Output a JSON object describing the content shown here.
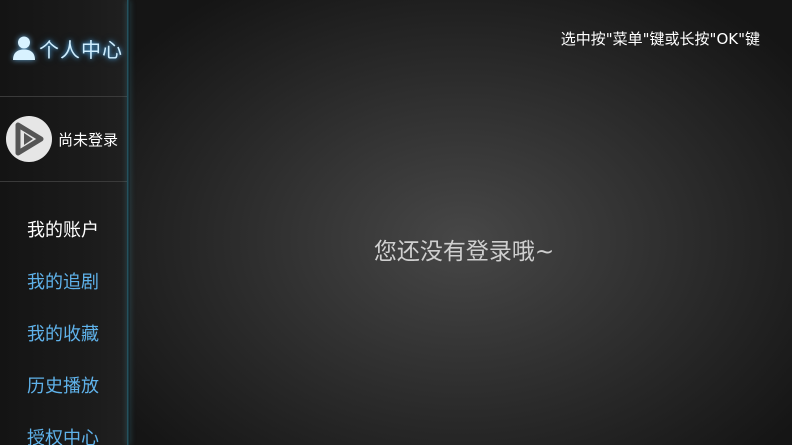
{
  "sidebar": {
    "title": "个人中心",
    "title_icon": "person-icon",
    "user": {
      "avatar_icon": "play-logo-icon",
      "status": "尚未登录"
    },
    "items": [
      {
        "label": "我的账户",
        "active": true
      },
      {
        "label": "我的追剧",
        "active": false
      },
      {
        "label": "我的收藏",
        "active": false
      },
      {
        "label": "历史播放",
        "active": false
      },
      {
        "label": "授权中心",
        "active": false
      }
    ]
  },
  "main": {
    "hint": "选中按\"菜单\"键或长按\"OK\"键",
    "empty_message": "您还没有登录哦~"
  },
  "colors": {
    "accent": "#5fb2ea",
    "title_glow": "#5abeff",
    "active_text": "#ffffff",
    "background": "#333333"
  }
}
